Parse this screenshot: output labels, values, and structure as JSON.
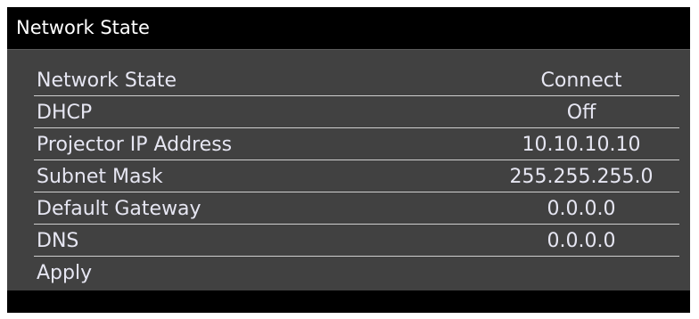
{
  "window": {
    "title": "Network State"
  },
  "rows": [
    {
      "label": "Network State",
      "value": "Connect"
    },
    {
      "label": "DHCP",
      "value": "Off"
    },
    {
      "label": "Projector IP Address",
      "value": "10.10.10.10"
    },
    {
      "label": "Subnet Mask",
      "value": "255.255.255.0"
    },
    {
      "label": "Default Gateway",
      "value": "0.0.0.0"
    },
    {
      "label": "DNS",
      "value": "0.0.0.0"
    }
  ],
  "apply_label": "Apply",
  "colors": {
    "panel_bg": "#414141",
    "titlebar_bg": "#000000",
    "text": "#e6e6f2",
    "divider": "#cfcfcf"
  }
}
